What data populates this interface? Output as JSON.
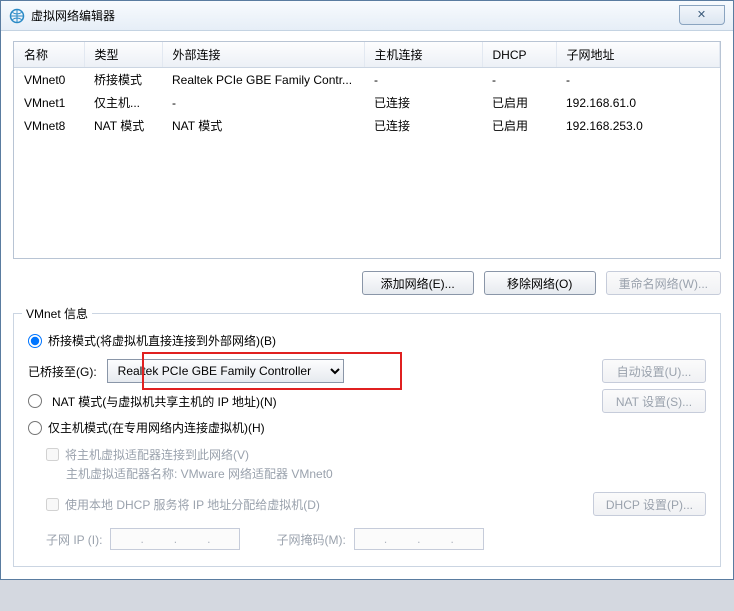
{
  "title": "虚拟网络编辑器",
  "columns": [
    "名称",
    "类型",
    "外部连接",
    "主机连接",
    "DHCP",
    "子网地址"
  ],
  "rows": [
    {
      "name": "VMnet0",
      "type": "桥接模式",
      "ext": "Realtek PCIe GBE Family Contr...",
      "host": "-",
      "dhcp": "-",
      "subnet": "-"
    },
    {
      "name": "VMnet1",
      "type": "仅主机...",
      "ext": "-",
      "host": "已连接",
      "dhcp": "已启用",
      "subnet": "192.168.61.0"
    },
    {
      "name": "VMnet8",
      "type": "NAT 模式",
      "ext": "NAT 模式",
      "host": "已连接",
      "dhcp": "已启用",
      "subnet": "192.168.253.0"
    }
  ],
  "actions": {
    "add": "添加网络(E)...",
    "remove": "移除网络(O)",
    "rename": "重命名网络(W)..."
  },
  "fieldset_legend": "VMnet 信息",
  "radio_bridge": "桥接模式(将虚拟机直接连接到外部网络)(B)",
  "bridge_to_label": "已桥接至(G):",
  "bridge_adapter": "Realtek PCIe GBE Family Controller",
  "auto_btn": "自动设置(U)...",
  "radio_nat": "NAT 模式(与虚拟机共享主机的 IP 地址)(N)",
  "nat_btn": "NAT 设置(S)...",
  "radio_host": "仅主机模式(在专用网络内连接虚拟机)(H)",
  "cb_connect": "将主机虚拟适配器连接到此网络(V)",
  "adapter_note": "主机虚拟适配器名称: VMware 网络适配器 VMnet0",
  "cb_dhcp": "使用本地 DHCP 服务将 IP 地址分配给虚拟机(D)",
  "dhcp_btn": "DHCP 设置(P)...",
  "subnet_ip_label": "子网 IP (I):",
  "subnet_mask_label": "子网掩码(M):"
}
